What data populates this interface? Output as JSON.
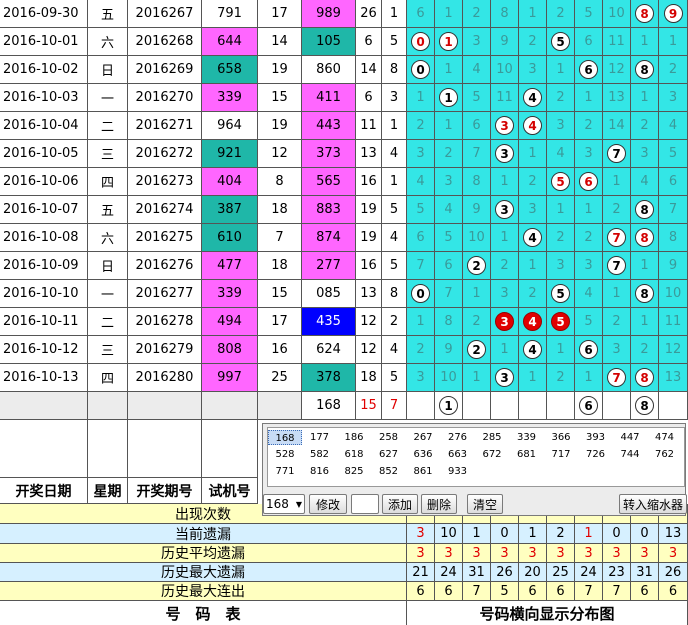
{
  "rows": [
    {
      "date": "2016-09-30",
      "week": "五",
      "period": "2016267",
      "trial": "791",
      "sum": "17",
      "num2": "989",
      "span": "26",
      "d": "1",
      "hl": [
        0,
        0,
        0,
        2
      ],
      "cells": [
        "6",
        "1",
        "2",
        "8",
        "1",
        "2",
        "5",
        "10",
        "8",
        "9"
      ]
    },
    {
      "date": "2016-10-01",
      "week": "六",
      "period": "2016268",
      "trial": "644",
      "sum": "14",
      "num2": "105",
      "span": "6",
      "d": "5",
      "hl": [
        1,
        0,
        2,
        0
      ],
      "cells": [
        "0",
        "1",
        "3",
        "9",
        "2",
        "5",
        "6",
        "11",
        "1",
        "1"
      ]
    },
    {
      "date": "2016-10-02",
      "week": "日",
      "period": "2016269",
      "trial": "658",
      "sum": "19",
      "num2": "860",
      "span": "14",
      "d": "8",
      "hl": [
        2,
        0,
        0,
        0
      ],
      "cells": [
        "0",
        "1",
        "4",
        "10",
        "3",
        "1",
        "6",
        "12",
        "8",
        "2"
      ]
    },
    {
      "date": "2016-10-03",
      "week": "一",
      "period": "2016270",
      "trial": "339",
      "sum": "15",
      "num2": "411",
      "span": "6",
      "d": "3",
      "hl": [
        1,
        0,
        2,
        0
      ],
      "cells": [
        "1",
        "1",
        "5",
        "11",
        "4",
        "2",
        "1",
        "13",
        "1",
        "3"
      ]
    },
    {
      "date": "2016-10-04",
      "week": "二",
      "period": "2016271",
      "trial": "964",
      "sum": "19",
      "num2": "443",
      "span": "11",
      "d": "1",
      "hl": [
        0,
        0,
        2,
        0
      ],
      "cells": [
        "2",
        "1",
        "6",
        "3",
        "4",
        "3",
        "2",
        "14",
        "2",
        "4"
      ]
    },
    {
      "date": "2016-10-05",
      "week": "三",
      "period": "2016272",
      "trial": "921",
      "sum": "12",
      "num2": "373",
      "span": "13",
      "d": "4",
      "hl": [
        2,
        0,
        2,
        0
      ],
      "cells": [
        "3",
        "2",
        "7",
        "3",
        "1",
        "4",
        "3",
        "7",
        "3",
        "5"
      ]
    },
    {
      "date": "2016-10-06",
      "week": "四",
      "period": "2016273",
      "trial": "404",
      "sum": "8",
      "num2": "565",
      "span": "16",
      "d": "1",
      "hl": [
        1,
        0,
        0,
        0
      ],
      "cells": [
        "4",
        "3",
        "8",
        "1",
        "2",
        "5",
        "6",
        "1",
        "4",
        "6"
      ]
    },
    {
      "date": "2016-10-07",
      "week": "五",
      "period": "2016274",
      "trial": "387",
      "sum": "18",
      "num2": "883",
      "span": "19",
      "d": "5",
      "hl": [
        2,
        0,
        2,
        0
      ],
      "cells": [
        "5",
        "4",
        "9",
        "3",
        "3",
        "1",
        "1",
        "2",
        "8",
        "7"
      ]
    },
    {
      "date": "2016-10-08",
      "week": "六",
      "period": "2016275",
      "trial": "610",
      "sum": "7",
      "num2": "874",
      "span": "19",
      "d": "4",
      "hl": [
        2,
        0,
        2,
        0
      ],
      "cells": [
        "6",
        "5",
        "10",
        "1",
        "4",
        "2",
        "2",
        "7",
        "8",
        "8"
      ]
    },
    {
      "date": "2016-10-09",
      "week": "日",
      "period": "2016276",
      "trial": "477",
      "sum": "18",
      "num2": "277",
      "span": "16",
      "d": "5",
      "hl": [
        1,
        0,
        2,
        0
      ],
      "cells": [
        "7",
        "6",
        "2",
        "2",
        "1",
        "3",
        "3",
        "7",
        "1",
        "9"
      ]
    },
    {
      "date": "2016-10-10",
      "week": "一",
      "period": "2016277",
      "trial": "339",
      "sum": "15",
      "num2": "085",
      "span": "13",
      "d": "8",
      "hl": [
        1,
        0,
        0,
        0
      ],
      "cells": [
        "0",
        "7",
        "1",
        "3",
        "2",
        "5",
        "4",
        "1",
        "8",
        "10"
      ]
    },
    {
      "date": "2016-10-11",
      "week": "二",
      "period": "2016278",
      "trial": "494",
      "sum": "17",
      "num2": "435",
      "span": "12",
      "d": "2",
      "hl": [
        1,
        0,
        3,
        0
      ],
      "cells": [
        "1",
        "8",
        "2",
        "3",
        "4",
        "5",
        "5",
        "2",
        "1",
        "11"
      ]
    },
    {
      "date": "2016-10-12",
      "week": "三",
      "period": "2016279",
      "trial": "808",
      "sum": "16",
      "num2": "624",
      "span": "12",
      "d": "4",
      "hl": [
        2,
        0,
        0,
        0
      ],
      "cells": [
        "2",
        "9",
        "2",
        "1",
        "4",
        "1",
        "6",
        "3",
        "2",
        "12"
      ]
    },
    {
      "date": "2016-10-13",
      "week": "四",
      "period": "2016280",
      "trial": "997",
      "sum": "25",
      "num2": "378",
      "span": "18",
      "d": "5",
      "hl": [
        1,
        0,
        2,
        0
      ],
      "cells": [
        "3",
        "10",
        "1",
        "3",
        "1",
        "2",
        "1",
        "7",
        "8",
        "13"
      ]
    }
  ],
  "summary_row": {
    "num2": "168",
    "span": "15",
    "d": "7",
    "balls": {
      "1": "1",
      "6": "6",
      "8": "8"
    }
  },
  "headers": {
    "date": "开奖日期",
    "week": "星期",
    "period": "开奖期号",
    "trial": "试机号"
  },
  "popup": {
    "items": [
      "168",
      "177",
      "186",
      "258",
      "267",
      "276",
      "285",
      "339",
      "366",
      "393",
      "447",
      "474",
      "528",
      "582",
      "618",
      "627",
      "636",
      "663",
      "672",
      "681",
      "717",
      "726",
      "744",
      "762",
      "771",
      "816",
      "825",
      "852",
      "861",
      "933"
    ],
    "combo_value": "168",
    "btn_modify": "修改",
    "btn_add": "添加",
    "btn_delete": "删除",
    "btn_clear": "清空",
    "btn_shrink": "转入缩水器"
  },
  "stats": {
    "labels": [
      "出现次数",
      "当前遗漏",
      "历史平均遗漏",
      "历史最大遗漏",
      "历史最大连出"
    ],
    "current": [
      "3",
      "10",
      "1",
      "0",
      "1",
      "2",
      "1",
      "0",
      "0",
      "13"
    ],
    "avg": [
      "3",
      "3",
      "3",
      "3",
      "3",
      "3",
      "3",
      "3",
      "3",
      "3"
    ],
    "max": [
      "21",
      "24",
      "31",
      "26",
      "20",
      "25",
      "24",
      "23",
      "31",
      "26"
    ],
    "maxrun": [
      "6",
      "6",
      "7",
      "5",
      "6",
      "6",
      "7",
      "7",
      "6",
      "6"
    ]
  },
  "footer": {
    "left": "号　码　表",
    "right": "号码横向显示分布图"
  },
  "colors": {
    "cyan": "#33e6e6",
    "magenta": "#ff66ff",
    "teal": "#1fb7a8",
    "blue": "#0000ff",
    "red": "#e00000"
  }
}
